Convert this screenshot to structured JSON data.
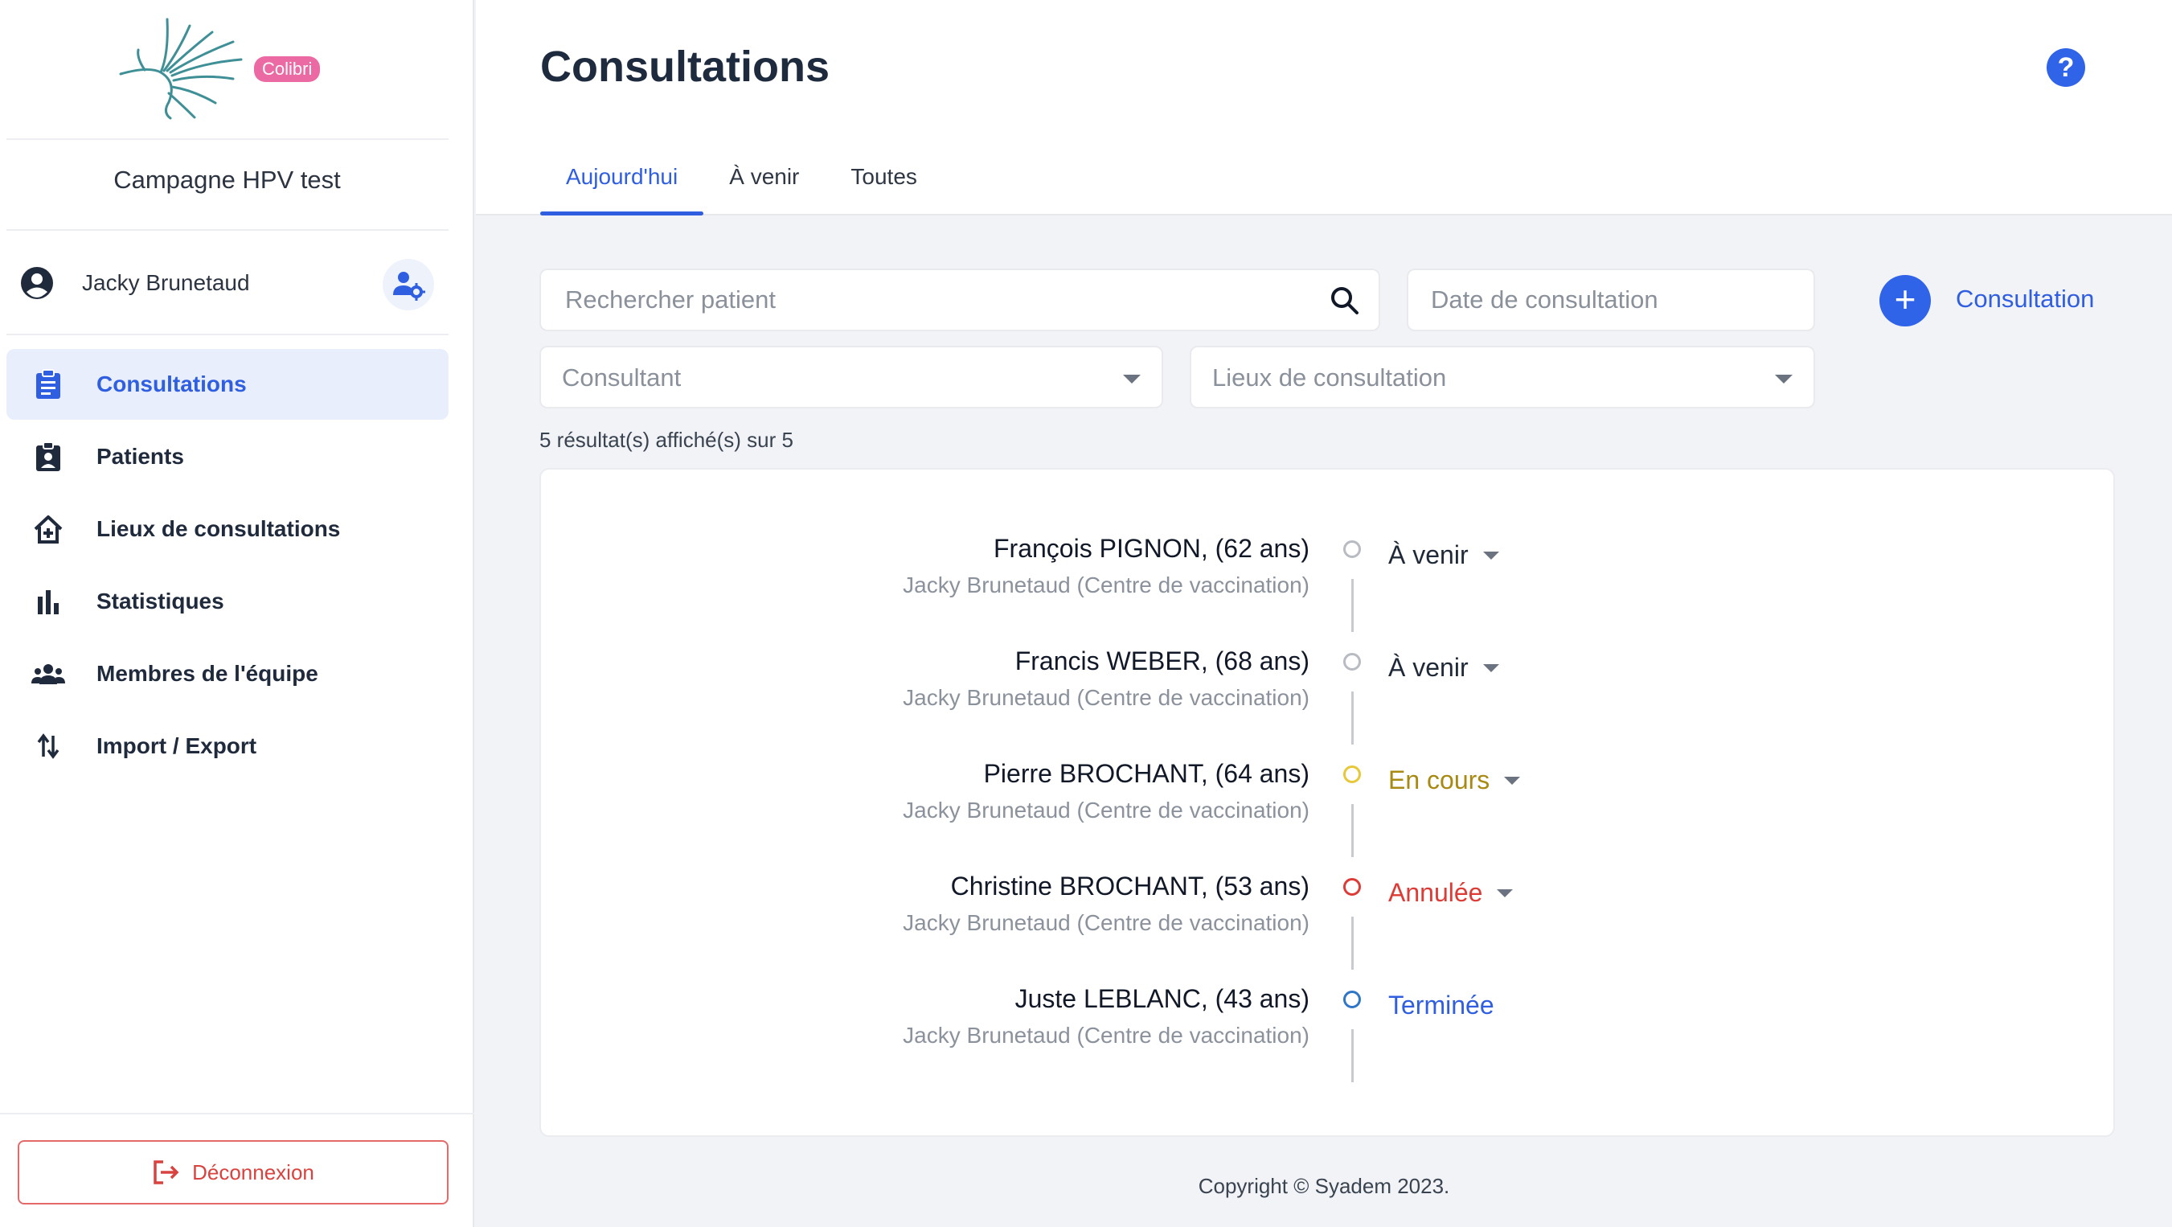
{
  "app": {
    "logo_badge": "Colibri",
    "campaign": "Campagne HPV test"
  },
  "user": {
    "name": "Jacky Brunetaud"
  },
  "sidebar": {
    "items": [
      {
        "label": "Consultations",
        "icon": "clipboard-icon",
        "active": true
      },
      {
        "label": "Patients",
        "icon": "badge-icon",
        "active": false
      },
      {
        "label": "Lieux de consultations",
        "icon": "house-plus-icon",
        "active": false
      },
      {
        "label": "Statistiques",
        "icon": "bar-chart-icon",
        "active": false
      },
      {
        "label": "Membres de l'équipe",
        "icon": "team-icon",
        "active": false
      },
      {
        "label": "Import / Export",
        "icon": "swap-vert-icon",
        "active": false
      }
    ],
    "logout_label": "Déconnexion"
  },
  "header": {
    "title": "Consultations",
    "tabs": [
      {
        "label": "Aujourd'hui",
        "active": true
      },
      {
        "label": "À venir",
        "active": false
      },
      {
        "label": "Toutes",
        "active": false
      }
    ]
  },
  "filters": {
    "search_placeholder": "Rechercher patient",
    "date_placeholder": "Date de consultation",
    "consultant_placeholder": "Consultant",
    "lieux_placeholder": "Lieux de consultation",
    "add_label": "Consultation",
    "result_count": "5 résultat(s) affiché(s) sur 5"
  },
  "consultations": [
    {
      "name": "François PIGNON, (62 ans)",
      "sub": "Jacky Brunetaud (Centre de vaccination)",
      "status": "À venir",
      "status_color": "#1f2937",
      "dot_color": "#b8bcc2",
      "dropdown": true
    },
    {
      "name": "Francis WEBER, (68 ans)",
      "sub": "Jacky Brunetaud (Centre de vaccination)",
      "status": "À venir",
      "status_color": "#1f2937",
      "dot_color": "#b8bcc2",
      "dropdown": true
    },
    {
      "name": "Pierre BROCHANT, (64 ans)",
      "sub": "Jacky Brunetaud (Centre de vaccination)",
      "status": "En cours",
      "status_color": "#a88a12",
      "dot_color": "#e7c83a",
      "dropdown": true
    },
    {
      "name": "Christine BROCHANT, (53 ans)",
      "sub": "Jacky Brunetaud (Centre de vaccination)",
      "status": "Annulée",
      "status_color": "#dc3b36",
      "dot_color": "#dc3b36",
      "dropdown": true
    },
    {
      "name": "Juste LEBLANC, (43 ans)",
      "sub": "Jacky Brunetaud (Centre de vaccination)",
      "status": "Terminée",
      "status_color": "#2f5ee0",
      "dot_color": "#2f76c9",
      "dropdown": false
    }
  ],
  "footer": {
    "copyright": "Copyright © Syadem 2023."
  }
}
